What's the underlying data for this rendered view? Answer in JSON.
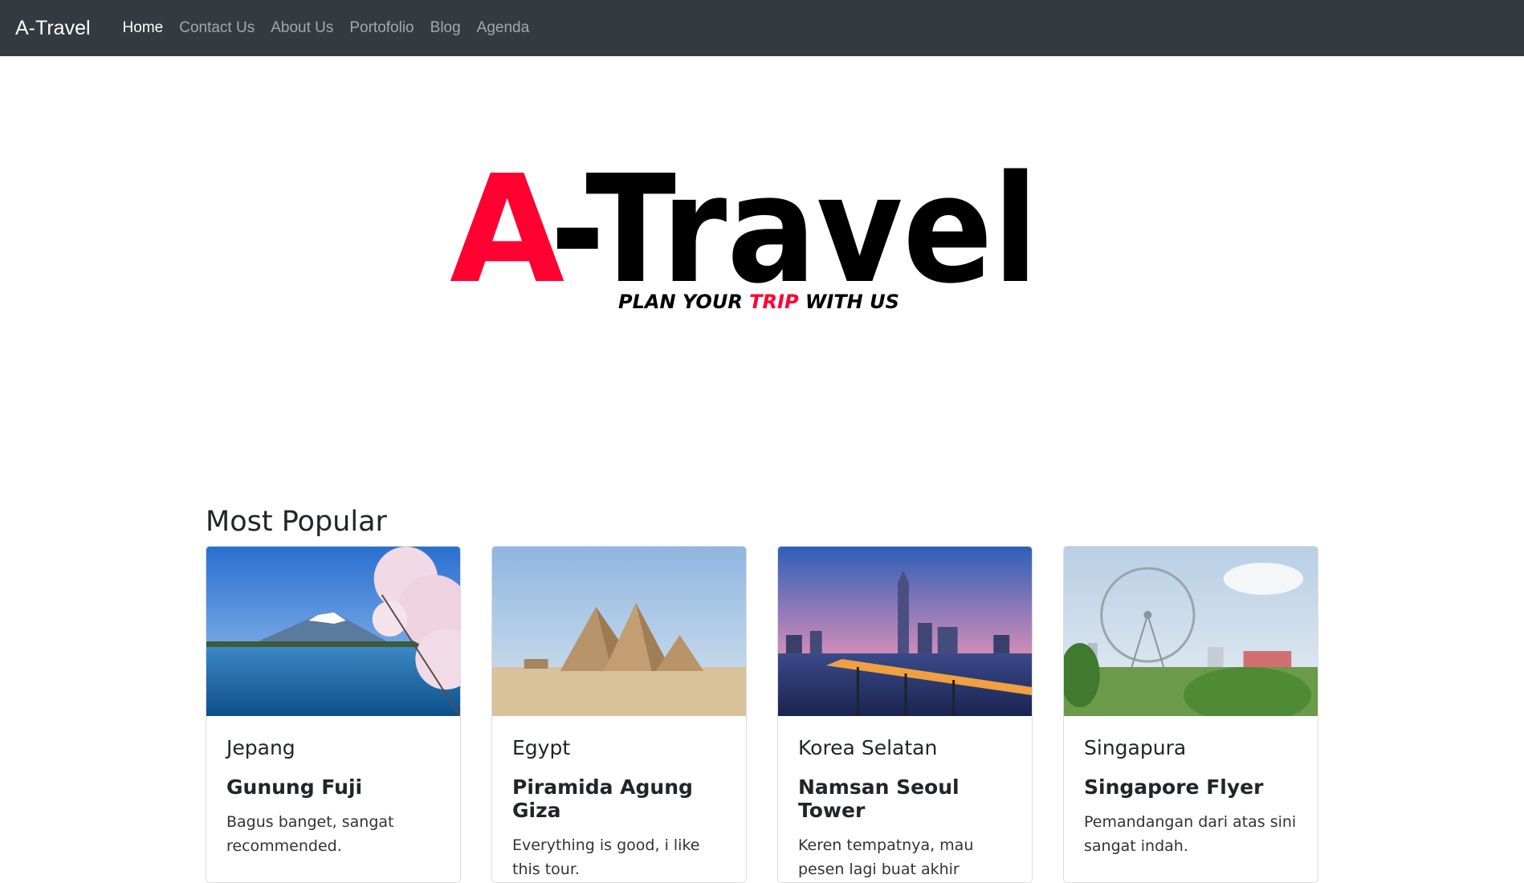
{
  "navbar": {
    "brand": "A-Travel",
    "links": [
      "Home",
      "Contact Us",
      "About Us",
      "Portofolio",
      "Blog",
      "Agenda"
    ]
  },
  "logo": {
    "title_a": "A",
    "title_rest": "-Travel",
    "tagline_1": "PLAN YOUR ",
    "tagline_2": "TRIP",
    "tagline_3": " WITH US",
    "accent_color": "#ff0030",
    "text_color": "#000000"
  },
  "popular": {
    "heading": "Most Popular",
    "cards": [
      {
        "country": "Jepang",
        "title": "Gunung Fuji",
        "text": "Bagus banget, sangat recommended.",
        "image": "mount-fuji-photo"
      },
      {
        "country": "Egypt",
        "title": "Piramida Agung Giza",
        "text": "Everything is good, i like this tour.",
        "image": "pyramids-photo"
      },
      {
        "country": "Korea Selatan",
        "title": "Namsan Seoul Tower",
        "text": "Keren tempatnya, mau pesen lagi buat akhir tahun.",
        "image": "seoul-skyline-photo"
      },
      {
        "country": "Singapura",
        "title": "Singapore Flyer",
        "text": "Pemandangan dari atas sini sangat indah.",
        "image": "singapore-flyer-photo"
      }
    ]
  },
  "colors": {
    "navbar_bg": "#343a40",
    "accent": "#ff0030"
  }
}
